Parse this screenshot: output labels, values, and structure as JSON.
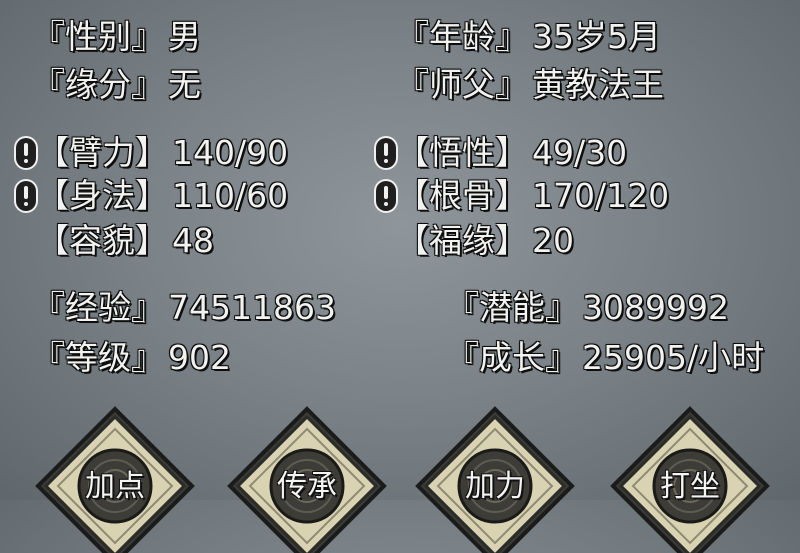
{
  "profile": {
    "gender": {
      "label": "『性别』",
      "value": "男"
    },
    "age": {
      "label": "『年龄』",
      "value": "35岁5月"
    },
    "fate": {
      "label": "『缘分』",
      "value": "无"
    },
    "master": {
      "label": "『师父』",
      "value": "黄教法王"
    }
  },
  "attributes": {
    "strength": {
      "label": "【臂力】",
      "value": "140/90",
      "warning": true
    },
    "comprehension": {
      "label": "【悟性】",
      "value": "49/30",
      "warning": true
    },
    "agility": {
      "label": "【身法】",
      "value": "110/60",
      "warning": true
    },
    "constitution": {
      "label": "【根骨】",
      "value": "170/120",
      "warning": true
    },
    "appearance": {
      "label": "【容貌】",
      "value": "48",
      "warning": false
    },
    "luck": {
      "label": "【福缘】",
      "value": "20",
      "warning": false
    }
  },
  "progress": {
    "experience": {
      "label": "『经验』",
      "value": "74511863"
    },
    "potential": {
      "label": "『潜能』",
      "value": "3089992"
    },
    "level": {
      "label": "『等级』",
      "value": "902"
    },
    "growth": {
      "label": "『成长』",
      "value": "25905/小时"
    }
  },
  "actions": {
    "add_points": "加点",
    "inherit": "传承",
    "add_force": "加力",
    "meditate": "打坐"
  },
  "colors": {
    "background": "#7b8388",
    "text": "#f2f2f0",
    "button_fill": "#d9d3b4",
    "button_border": "#1b1b1b",
    "warning_icon": "#1f1f1f"
  },
  "icons": {
    "warning": "exclamation-icon",
    "button_orb": "swirl-orb-icon"
  }
}
